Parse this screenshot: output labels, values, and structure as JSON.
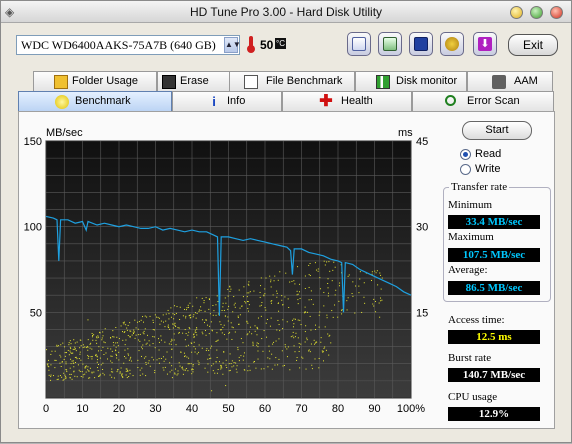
{
  "window": {
    "title": "HD Tune Pro 3.00 - Hard Disk Utility"
  },
  "toolbar": {
    "drive": "WDC WD6400AAKS-75A7B (640 GB)",
    "temperature": "50",
    "temperature_unit": "°C",
    "exit_label": "Exit",
    "icons": [
      "copy-info-icon",
      "copy-screenshot-icon",
      "save-icon",
      "options-icon",
      "download-icon"
    ]
  },
  "tabs_top": [
    {
      "label": "Folder Usage",
      "icon": "folder-icon"
    },
    {
      "label": "Erase",
      "icon": "trash-icon"
    },
    {
      "label": "File Benchmark",
      "icon": "file-benchmark-icon"
    },
    {
      "label": "Disk monitor",
      "icon": "monitor-chart-icon"
    },
    {
      "label": "AAM",
      "icon": "speaker-icon"
    }
  ],
  "tabs_bottom": [
    {
      "label": "Benchmark",
      "icon": "lightbulb-icon",
      "active": true
    },
    {
      "label": "Info",
      "icon": "info-icon",
      "active": false
    },
    {
      "label": "Health",
      "icon": "health-cross-icon",
      "active": false
    },
    {
      "label": "Error Scan",
      "icon": "magnifier-icon",
      "active": false
    }
  ],
  "controls": {
    "start_label": "Start",
    "read_label": "Read",
    "write_label": "Write",
    "mode_selected": "Read"
  },
  "stats": {
    "transfer_rate_title": "Transfer rate",
    "minimum_label": "Minimum",
    "minimum_value": "33.4 MB/sec",
    "maximum_label": "Maximum",
    "maximum_value": "107.5 MB/sec",
    "average_label": "Average:",
    "average_value": "86.5 MB/sec",
    "access_time_label": "Access time:",
    "access_time_value": "12.5 ms",
    "burst_rate_label": "Burst rate",
    "burst_rate_value": "140.7 MB/sec",
    "cpu_usage_label": "CPU usage",
    "cpu_usage_value": "12.9%"
  },
  "chart_data": {
    "type": "line",
    "y_left_label": "MB/sec",
    "y_right_label": "ms",
    "y_left_ticks": [
      "150",
      "100",
      "50"
    ],
    "y_right_ticks": [
      "45",
      "30",
      "15"
    ],
    "x_ticks": [
      "0",
      "10",
      "20",
      "30",
      "40",
      "50",
      "60",
      "70",
      "80",
      "90",
      "100%"
    ],
    "xlim": [
      0,
      100
    ],
    "ylim_left": [
      0,
      150
    ],
    "ylim_right": [
      0,
      45
    ],
    "grid": true,
    "background": "#000000",
    "series": [
      {
        "color": "#1ea0e0",
        "axis": "left",
        "points": [
          [
            0,
            106
          ],
          [
            2,
            105
          ],
          [
            3,
            104
          ],
          [
            3.5,
            80
          ],
          [
            4,
            104
          ],
          [
            6,
            104
          ],
          [
            8,
            102
          ],
          [
            10,
            103
          ],
          [
            11,
            98
          ],
          [
            11.5,
            103
          ],
          [
            14,
            101
          ],
          [
            16,
            102
          ],
          [
            18,
            101
          ],
          [
            20,
            100
          ],
          [
            22,
            101
          ],
          [
            24,
            100
          ],
          [
            26,
            99
          ],
          [
            28,
            99
          ],
          [
            30,
            100
          ],
          [
            32,
            98
          ],
          [
            34,
            99
          ],
          [
            36,
            98
          ],
          [
            38,
            97
          ],
          [
            40,
            98
          ],
          [
            42,
            97
          ],
          [
            44,
            97
          ],
          [
            46,
            95
          ],
          [
            47,
            94
          ],
          [
            47.5,
            48
          ],
          [
            48,
            94
          ],
          [
            50,
            94
          ],
          [
            52,
            93
          ],
          [
            54,
            92
          ],
          [
            56,
            93
          ],
          [
            58,
            92
          ],
          [
            60,
            91
          ],
          [
            62,
            90
          ],
          [
            64,
            89
          ],
          [
            66,
            88
          ],
          [
            67,
            86
          ],
          [
            67.5,
            72
          ],
          [
            68,
            87
          ],
          [
            70,
            87
          ],
          [
            72,
            85
          ],
          [
            74,
            84
          ],
          [
            76,
            83
          ],
          [
            78,
            81
          ],
          [
            80,
            80
          ],
          [
            81,
            79
          ],
          [
            81.5,
            50
          ],
          [
            82,
            79
          ],
          [
            84,
            78
          ],
          [
            86,
            75
          ],
          [
            88,
            73
          ],
          [
            90,
            71
          ],
          [
            92,
            69
          ],
          [
            94,
            67
          ],
          [
            96,
            65
          ],
          [
            98,
            62
          ],
          [
            100,
            60
          ]
        ]
      },
      {
        "color": "#e8e830",
        "axis": "right",
        "type": "scatter",
        "description_range": "access time samples roughly 4-22 ms spread across capacity"
      }
    ]
  }
}
